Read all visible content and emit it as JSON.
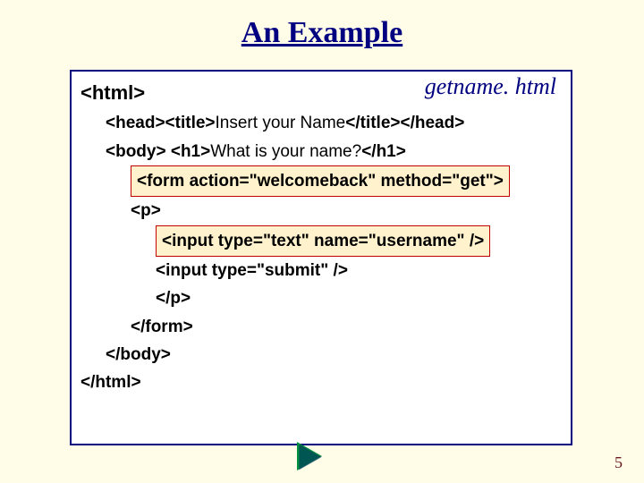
{
  "title": "An Example",
  "filename": "getname. html",
  "code": {
    "l1": "<html>",
    "l2_a": "<head><title>",
    "l2_b": "Insert your Name",
    "l2_c": "</title></head>",
    "l3_a": "<body> <h1>",
    "l3_b": "What is your name?",
    "l3_c": "</h1>",
    "l4": "<form action=\"welcomeback\" method=\"get\">",
    "l5": "<p>",
    "l6": "<input type=\"text\" name=\"username\" />",
    "l7": "<input type=\"submit\" />",
    "l8": "</p>",
    "l9": "</form>",
    "l10": "</body>",
    "l11": "</html>"
  },
  "page_number": "5"
}
